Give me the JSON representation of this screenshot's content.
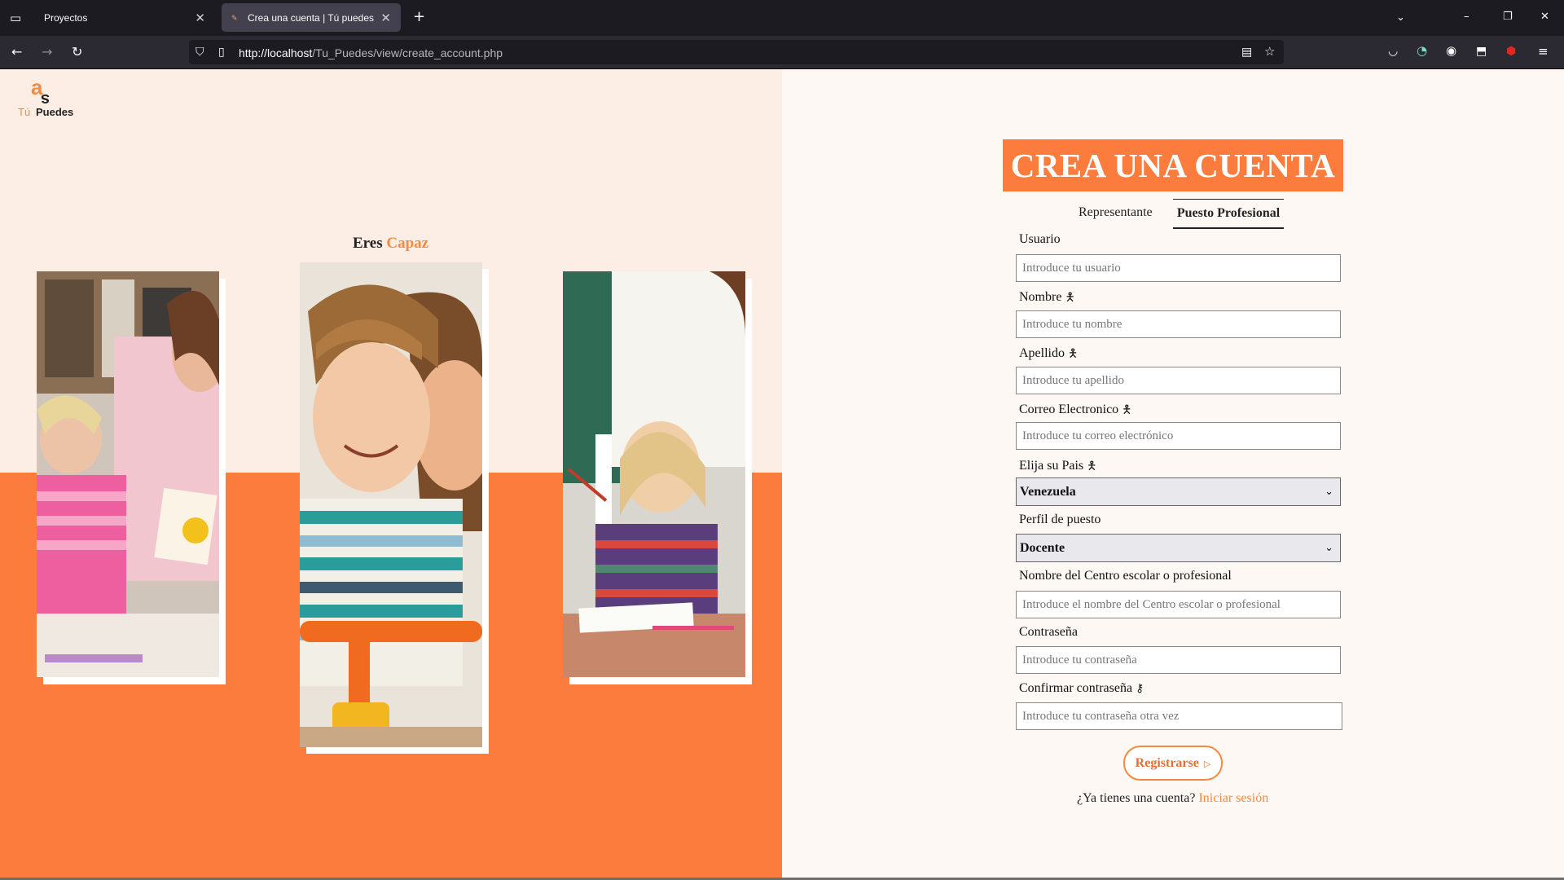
{
  "browser": {
    "tabs": [
      {
        "title": "Proyectos",
        "active": false
      },
      {
        "title": "Crea una cuenta | Tú puedes",
        "active": true
      }
    ],
    "url_host": "http://localhost",
    "url_path": "/Tu_Puedes/view/create_account.php",
    "icons": [
      "tab-overview-icon",
      "close-icon",
      "new-tab-icon",
      "tab-list-icon",
      "minimize-icon",
      "restore-icon",
      "window-close-icon",
      "back-icon",
      "forward-icon",
      "reload-icon",
      "shield-icon",
      "page-icon",
      "reader-icon",
      "bookmark-star-icon",
      "pocket-icon",
      "sync-icon",
      "account-icon",
      "extensions-icon",
      "ublock-icon",
      "menu-icon"
    ]
  },
  "logo": {
    "letter_a": "a",
    "letter_s": "s",
    "word_tu": "Tú",
    "word_puedes": "Puedes"
  },
  "hero": {
    "tagline_prefix": "Eres",
    "tagline_highlight": "Capaz"
  },
  "colors": {
    "accent": "#fb7c3d",
    "accent_text": "#f48a3f",
    "left_bg": "#fdeee5",
    "right_bg": "#fdf8f4"
  },
  "form": {
    "title": "CREA UNA CUENTA",
    "tabs": [
      {
        "label": "Representante",
        "active": false
      },
      {
        "label": "Puesto Profesional",
        "active": true
      }
    ],
    "fields": {
      "usuario": {
        "label": "Usuario",
        "placeholder": "Introduce tu usuario"
      },
      "nombre": {
        "label": "Nombre",
        "placeholder": "Introduce tu nombre",
        "icon": "person-icon"
      },
      "apellido": {
        "label": "Apellido",
        "placeholder": "Introduce tu apellido",
        "icon": "person-icon"
      },
      "correo": {
        "label": "Correo Electronico",
        "placeholder": "Introduce tu correo electrónico",
        "icon": "person-icon"
      },
      "pais": {
        "label": "Elija su Pais",
        "value": "Venezuela",
        "icon": "person-icon"
      },
      "perfil": {
        "label": "Perfil de puesto",
        "value": "Docente"
      },
      "centro": {
        "label": "Nombre del Centro escolar o profesional",
        "placeholder": "Introduce el nombre del Centro escolar o profesional"
      },
      "contrasena": {
        "label": "Contraseña",
        "placeholder": "Introduce tu contraseña"
      },
      "confirmar": {
        "label": "Confirmar contraseña",
        "placeholder": "Introduce tu contraseña otra vez",
        "icon": "key-icon"
      }
    },
    "submit_label": "Registrarse",
    "login_prompt": "¿Ya tienes una cuenta?",
    "login_link": "Iniciar sesión"
  }
}
